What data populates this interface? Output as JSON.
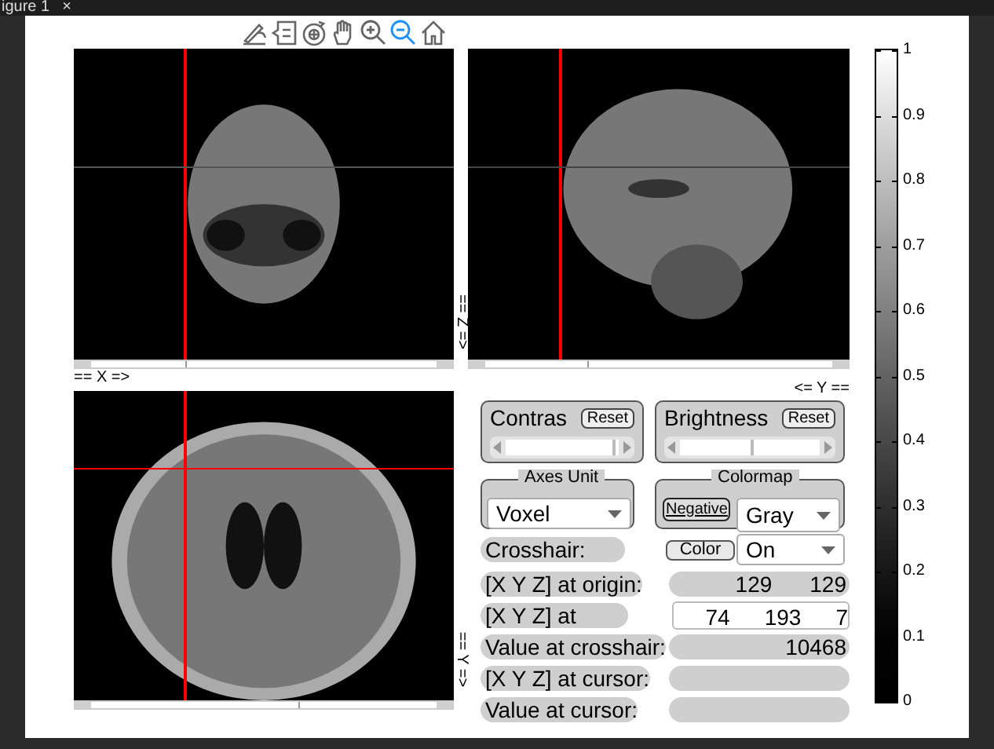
{
  "window": {
    "title": "igure 1",
    "close": "×"
  },
  "toolbar": [
    {
      "kind": "edit",
      "selected": false
    },
    {
      "kind": "legend",
      "selected": false
    },
    {
      "kind": "rotate",
      "selected": false
    },
    {
      "kind": "pan",
      "selected": false
    },
    {
      "kind": "zoom_in",
      "selected": false
    },
    {
      "kind": "zoom_out",
      "selected": true
    },
    {
      "kind": "home",
      "selected": false
    }
  ],
  "views": [
    {
      "kind": "coronal",
      "axis_label": "== X =>",
      "slider": {
        "level": 0.29
      }
    },
    {
      "kind": "sagittal",
      "axis_label": "== Z =>",
      "slider": {
        "level": 0.31
      }
    },
    {
      "kind": "axial",
      "axis_label": "== Y =>",
      "slider": {
        "level": 0.59
      }
    }
  ],
  "sagittal_bottom_label": "<= Y ==",
  "colorbar": {
    "ticks": [
      "1",
      "0.9",
      "0.8",
      "0.7",
      "0.6",
      "0.5",
      "0.4",
      "0.3",
      "0.2",
      "0.1",
      "0"
    ]
  },
  "contrast": {
    "title": "Contras",
    "reset": "Reset",
    "level": 0.95
  },
  "brightness": {
    "title": "Brightness",
    "reset": "Reset",
    "level": 0.5
  },
  "axes_unit": {
    "title": "Axes Unit",
    "value": "Voxel"
  },
  "colormap": {
    "title": "Colormap",
    "negative": "Negative",
    "value": "Gray"
  },
  "crosshair": {
    "label": "Crosshair:",
    "color_button": "Color",
    "value": "On"
  },
  "rows": [
    {
      "kind": "values",
      "label": "[X Y Z] at origin:",
      "values": [
        "129",
        "129"
      ]
    },
    {
      "kind": "input",
      "label": "[X Y Z] at",
      "values": [
        "74",
        "193",
        "7"
      ]
    },
    {
      "kind": "values",
      "label": "Value at crosshair:",
      "values": [
        "10468"
      ]
    },
    {
      "kind": "values",
      "label": "[X Y Z] at cursor:",
      "values": []
    },
    {
      "kind": "values",
      "label": "Value at cursor:",
      "values": []
    }
  ]
}
